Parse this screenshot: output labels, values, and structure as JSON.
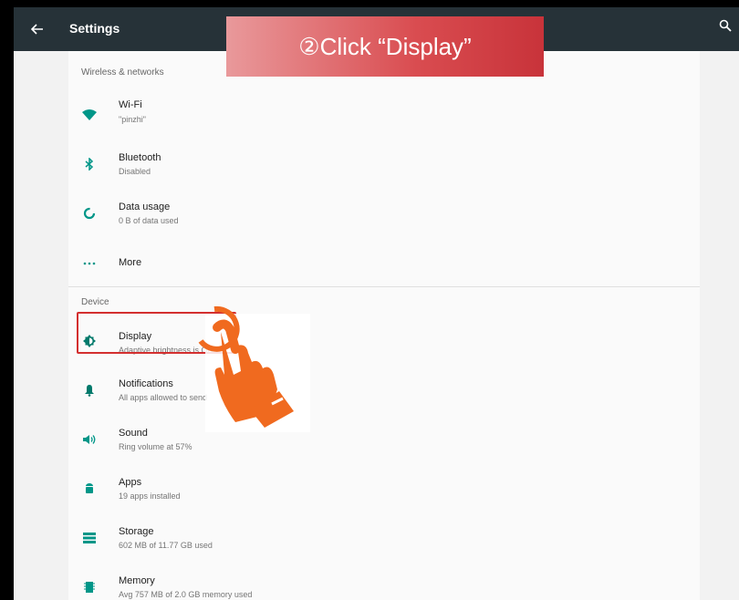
{
  "appbar": {
    "title": "Settings"
  },
  "sections": {
    "wireless": "Wireless & networks",
    "device": "Device"
  },
  "items": {
    "wifi": {
      "label": "Wi-Fi",
      "sub": "\"pinzhi\""
    },
    "bluetooth": {
      "label": "Bluetooth",
      "sub": "Disabled"
    },
    "data_usage": {
      "label": "Data usage",
      "sub": "0 B of data used"
    },
    "more": {
      "label": "More"
    },
    "display": {
      "label": "Display",
      "sub": "Adaptive brightness is ON"
    },
    "notifications": {
      "label": "Notifications",
      "sub": "All apps allowed to send"
    },
    "sound": {
      "label": "Sound",
      "sub": "Ring volume at 57%"
    },
    "apps": {
      "label": "Apps",
      "sub": "19 apps installed"
    },
    "storage": {
      "label": "Storage",
      "sub": "602 MB of 11.77 GB used"
    },
    "memory": {
      "label": "Memory",
      "sub": "Avg 757 MB of 2.0 GB memory used"
    }
  },
  "callout": {
    "text": "②Click “Display”"
  },
  "colors": {
    "appbar": "#263238",
    "accent": "#009688",
    "highlight": "#d32f2f",
    "hand": "#f06a1f"
  },
  "icons": {
    "wifi": "wifi-icon",
    "bluetooth": "bluetooth-icon",
    "data_usage": "data-usage-icon",
    "more": "more-icon",
    "display": "brightness-icon",
    "notifications": "bell-icon",
    "sound": "volume-icon",
    "apps": "android-icon",
    "storage": "storage-icon",
    "memory": "memory-chip-icon"
  }
}
